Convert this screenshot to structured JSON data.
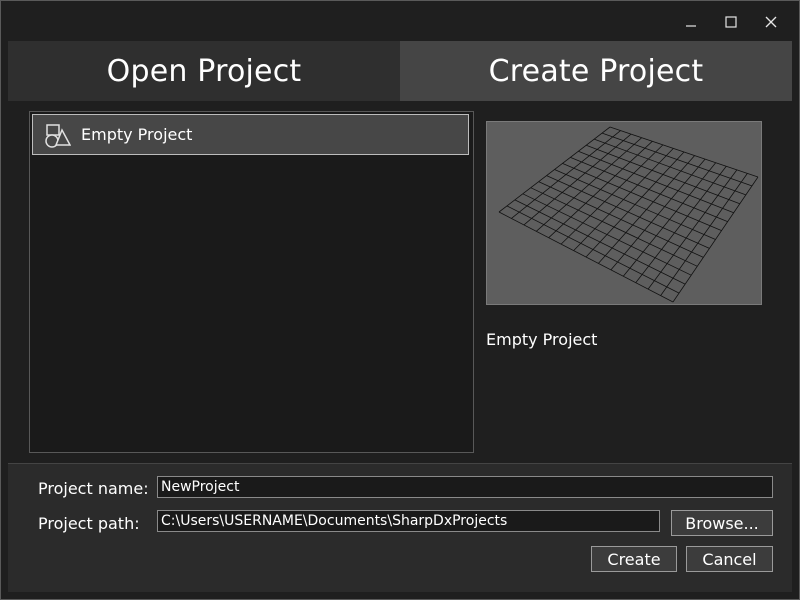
{
  "window": {
    "controls": {
      "minimize_glyph": "–",
      "maximize_glyph": "□",
      "close_glyph": "✕"
    }
  },
  "tabs": [
    {
      "label": "Open Project",
      "selected": false
    },
    {
      "label": "Create Project",
      "selected": true
    }
  ],
  "templates": [
    {
      "label": "Empty Project",
      "icon": "shapes-icon",
      "selected": true
    }
  ],
  "preview": {
    "image": "grid-plane-preview",
    "title": "Empty Project"
  },
  "form": {
    "name_label": "Project name:",
    "name_value": "NewProject",
    "path_label": "Project path:",
    "path_value": "C:\\Users\\USERNAME\\Documents\\SharpDxProjects",
    "browse_label": "Browse...",
    "create_label": "Create",
    "cancel_label": "Cancel"
  },
  "colors": {
    "window_bg": "#1f1f1f",
    "tab_active": "#454545",
    "tab_inactive": "#2f2f2f",
    "selection": "#474747",
    "preview_bg": "#5e5e5e"
  }
}
